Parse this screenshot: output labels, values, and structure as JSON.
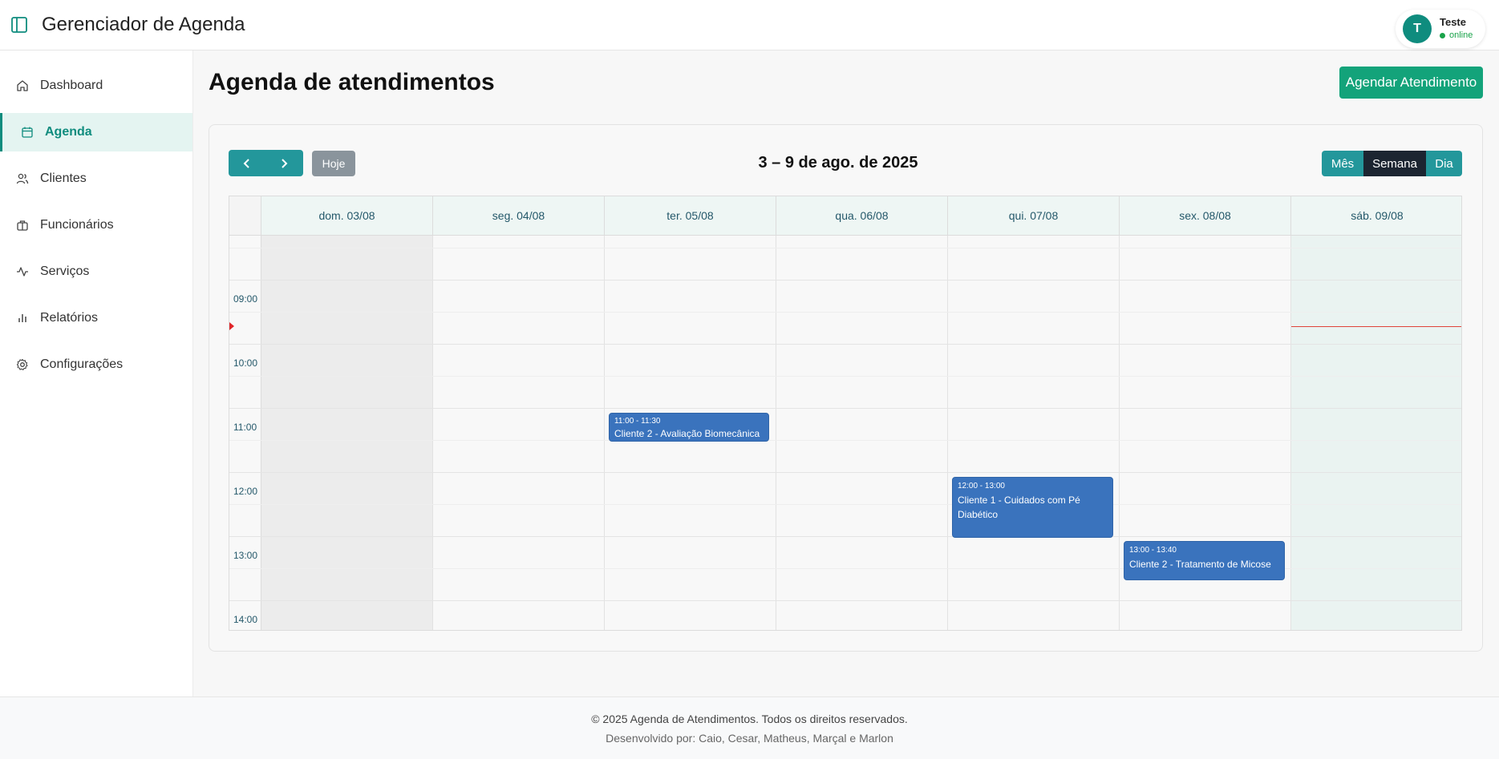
{
  "header": {
    "app_title": "Gerenciador de Agenda",
    "user": {
      "initial": "T",
      "name": "Teste",
      "status": "online"
    }
  },
  "sidebar": {
    "items": [
      {
        "label": "Dashboard",
        "icon": "home-icon",
        "active": false
      },
      {
        "label": "Agenda",
        "icon": "calendar-icon",
        "active": true
      },
      {
        "label": "Clientes",
        "icon": "users-icon",
        "active": false
      },
      {
        "label": "Funcionários",
        "icon": "briefcase-icon",
        "active": false
      },
      {
        "label": "Serviços",
        "icon": "activity-icon",
        "active": false
      },
      {
        "label": "Relatórios",
        "icon": "bar-chart-icon",
        "active": false
      },
      {
        "label": "Configurações",
        "icon": "gear-icon",
        "active": false
      }
    ]
  },
  "main": {
    "title": "Agenda de atendimentos",
    "schedule_button": "Agendar Atendimento"
  },
  "calendar": {
    "today_button": "Hoje",
    "range_title": "3 – 9 de ago. de 2025",
    "views": [
      {
        "label": "Mês",
        "active": false
      },
      {
        "label": "Semana",
        "active": true
      },
      {
        "label": "Dia",
        "active": false
      }
    ],
    "days": [
      "dom. 03/08",
      "seg. 04/08",
      "ter. 05/08",
      "qua. 06/08",
      "qui. 07/08",
      "sex. 08/08",
      "sáb. 09/08"
    ],
    "time_labels": [
      "09:00",
      "10:00",
      "11:00",
      "12:00",
      "13:00",
      "14:00"
    ],
    "events": [
      {
        "time": "11:00 - 11:30",
        "title": "Cliente 2 - Avaliação Biomecânica",
        "day": "ter. 05/08"
      },
      {
        "time": "12:00 - 13:00",
        "title": "Cliente 1 - Cuidados com Pé Diabético",
        "day": "qui. 07/08"
      },
      {
        "time": "13:00 - 13:40",
        "title": "Cliente 2 - Tratamento de Micose",
        "day": "sex. 08/08"
      }
    ]
  },
  "footer": {
    "copyright": "© 2025 Agenda de Atendimentos. Todos os direitos reservados.",
    "credits": "Desenvolvido por: Caio, Cesar, Matheus, Marçal e Marlon"
  },
  "colors": {
    "accent": "#0f8c7e",
    "teal_button": "#23979b",
    "primary_button": "#13a37a",
    "event": "#3a73bd",
    "now_line": "#e0443a",
    "active_view": "#1c2531"
  }
}
